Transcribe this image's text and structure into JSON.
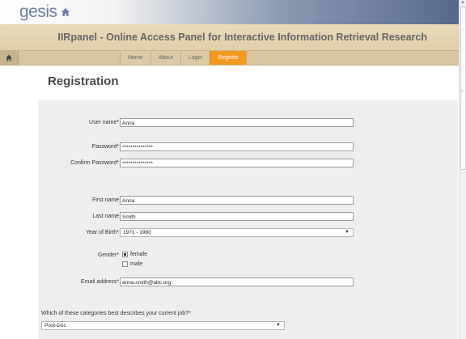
{
  "header": {
    "logo_text": "gesis",
    "banner_title": "IIRpanel - Online Access Panel for Interactive Information Retrieval Research"
  },
  "nav": {
    "items": [
      {
        "label": "Home",
        "active": false
      },
      {
        "label": "About",
        "active": false
      },
      {
        "label": "Login",
        "active": false
      },
      {
        "label": "Register",
        "active": true
      }
    ]
  },
  "page_title": "Registration",
  "form": {
    "username": {
      "label": "User name*",
      "value": "Anna"
    },
    "password": {
      "label": "Password*",
      "value": "***************"
    },
    "confirm_password": {
      "label": "Confirm Password*",
      "value": "***************"
    },
    "first_name": {
      "label": "First name",
      "value": "Anna"
    },
    "last_name": {
      "label": "Last name",
      "value": "Smith"
    },
    "year_of_birth": {
      "label": "Year of Birth*",
      "value": "1971 - 1980"
    },
    "gender": {
      "label": "Gender*",
      "options": [
        {
          "label": "female",
          "checked": true
        },
        {
          "label": "male",
          "checked": false
        }
      ]
    },
    "email": {
      "label": "Email address*",
      "value": "anna.smith@abc.org"
    },
    "job_question": "Which of these categories best describes your current job?*",
    "job_value": "Post-Doc"
  },
  "colors": {
    "accent": "#f39a1e",
    "banner": "#e0cfa8",
    "panel": "#eeeeee"
  }
}
